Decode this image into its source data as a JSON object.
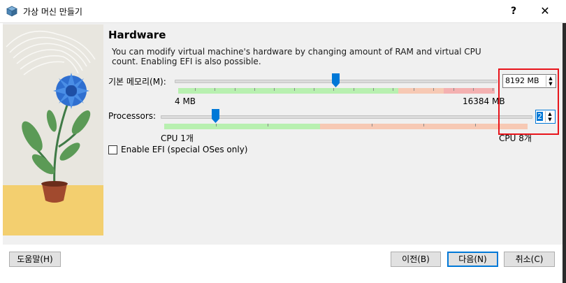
{
  "window": {
    "title": "가상 머신 만들기",
    "help_button": "?",
    "close_button": "✕",
    "app_icon": "virtualbox-cube-icon"
  },
  "page": {
    "heading": "Hardware",
    "description": "You can modify virtual machine's hardware by changing amount of RAM and virtual CPU count. Enabling EFI is also possible."
  },
  "memory": {
    "label": "기본 메모리(M):",
    "value": "8192 MB",
    "min_label": "4 MB",
    "max_label": "16384 MB",
    "value_fraction": 0.5
  },
  "processors": {
    "label": "Processors:",
    "value": "2",
    "min_label": "CPU 1개",
    "max_label": "CPU 8개",
    "value_fraction": 0.143
  },
  "efi": {
    "label": "Enable EFI (special OSes only)",
    "checked": false
  },
  "buttons": {
    "help": "도움말(H)",
    "back": "이전(B)",
    "next": "다음(N)",
    "cancel": "취소(C)"
  },
  "colors": {
    "slider_handle": "#0078d7",
    "zone_safe": "#b8f0b0",
    "zone_caution": "#f7c9b4",
    "zone_danger": "#f4b1b1",
    "highlight": "#e8141b",
    "art_sky": "#e8e6df",
    "art_ground": "#f3cf6f"
  }
}
